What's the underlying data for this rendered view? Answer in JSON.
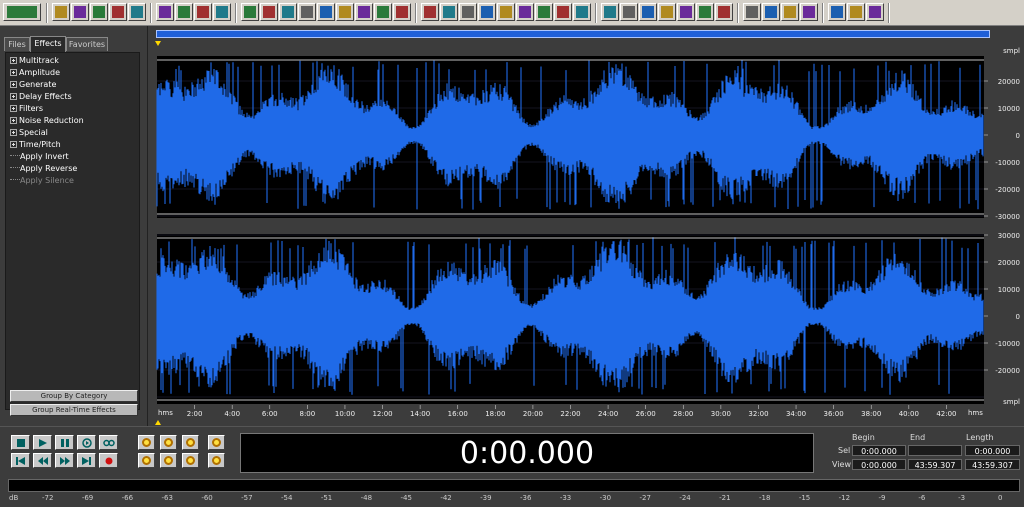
{
  "toolbar": {
    "groups": [
      [
        "fx-window-icon"
      ],
      [
        "new-file-icon",
        "open-file-icon",
        "save-file-icon",
        "save-as-icon",
        "close-file-icon"
      ],
      [
        "edit-wave-icon",
        "edit-multitrack-icon",
        "edit-cd-icon",
        "view-cd-icon"
      ],
      [
        "mix-icon",
        "undo-icon",
        "trim-icon",
        "cue-icon",
        "loop-icon",
        "envelope-icon",
        "marker-icon",
        "region-icon",
        "snap-icon"
      ],
      [
        "graphic-eq-icon",
        "amplify-icon",
        "fade-icon",
        "normalize-icon",
        "filter-icon",
        "noise-icon",
        "reverb-icon",
        "pitch-icon",
        "tempo-icon"
      ],
      [
        "spectral-view-icon",
        "spectrum-icon",
        "analyze-icon",
        "frequency-icon",
        "phase-icon",
        "stats-icon",
        "info-icon"
      ],
      [
        "settings-icon",
        "batch-icon",
        "scripts-icon",
        "midi-icon"
      ],
      [
        "help-icon",
        "about-icon",
        "favorite-icon"
      ]
    ]
  },
  "left_panel": {
    "tabs": [
      "Files",
      "Effects",
      "Favorites"
    ],
    "active_tab": "Effects",
    "tree": [
      {
        "label": "Multitrack",
        "expandable": true
      },
      {
        "label": "Amplitude",
        "expandable": true
      },
      {
        "label": "Generate",
        "expandable": true
      },
      {
        "label": "Delay Effects",
        "expandable": true
      },
      {
        "label": "Filters",
        "expandable": true
      },
      {
        "label": "Noise Reduction",
        "expandable": true
      },
      {
        "label": "Special",
        "expandable": true
      },
      {
        "label": "Time/Pitch",
        "expandable": true
      },
      {
        "label": "Apply Invert",
        "expandable": false
      },
      {
        "label": "Apply Reverse",
        "expandable": false
      },
      {
        "label": "Apply Silence",
        "expandable": false,
        "disabled": true
      }
    ],
    "buttons": [
      "Group By Category",
      "Group Real-Time Effects"
    ]
  },
  "waveform": {
    "unit_label": "smpl",
    "channel1_ticks": [
      "20000",
      "10000",
      "0",
      "-10000",
      "-20000",
      "-30000"
    ],
    "channel2_ticks": [
      "30000",
      "20000",
      "10000",
      "0",
      "-10000",
      "-20000"
    ],
    "time_unit": "hms",
    "time_ticks": [
      "2:00",
      "4:00",
      "6:00",
      "8:00",
      "10:00",
      "12:00",
      "14:00",
      "16:00",
      "18:00",
      "20:00",
      "22:00",
      "24:00",
      "26:00",
      "28:00",
      "30:00",
      "32:00",
      "34:00",
      "36:00",
      "38:00",
      "40:00",
      "42:00"
    ],
    "wave_color": "#1f6ae8",
    "background_color": "#000000"
  },
  "transport": {
    "time": "0:00.000",
    "headers": {
      "begin": "Begin",
      "end": "End",
      "length": "Length"
    },
    "sel": {
      "label": "Sel",
      "begin": "0:00.000",
      "end": "",
      "length": "0:00.000"
    },
    "view": {
      "label": "View",
      "begin": "0:00.000",
      "end": "43:59.307",
      "length": "43:59.307"
    }
  },
  "meter": {
    "unit": "dB",
    "ticks": [
      "-72",
      "-69",
      "-66",
      "-63",
      "-60",
      "-57",
      "-54",
      "-51",
      "-48",
      "-45",
      "-42",
      "-39",
      "-36",
      "-33",
      "-30",
      "-27",
      "-24",
      "-21",
      "-18",
      "-15",
      "-12",
      "-9",
      "-6",
      "-3",
      "0"
    ]
  }
}
